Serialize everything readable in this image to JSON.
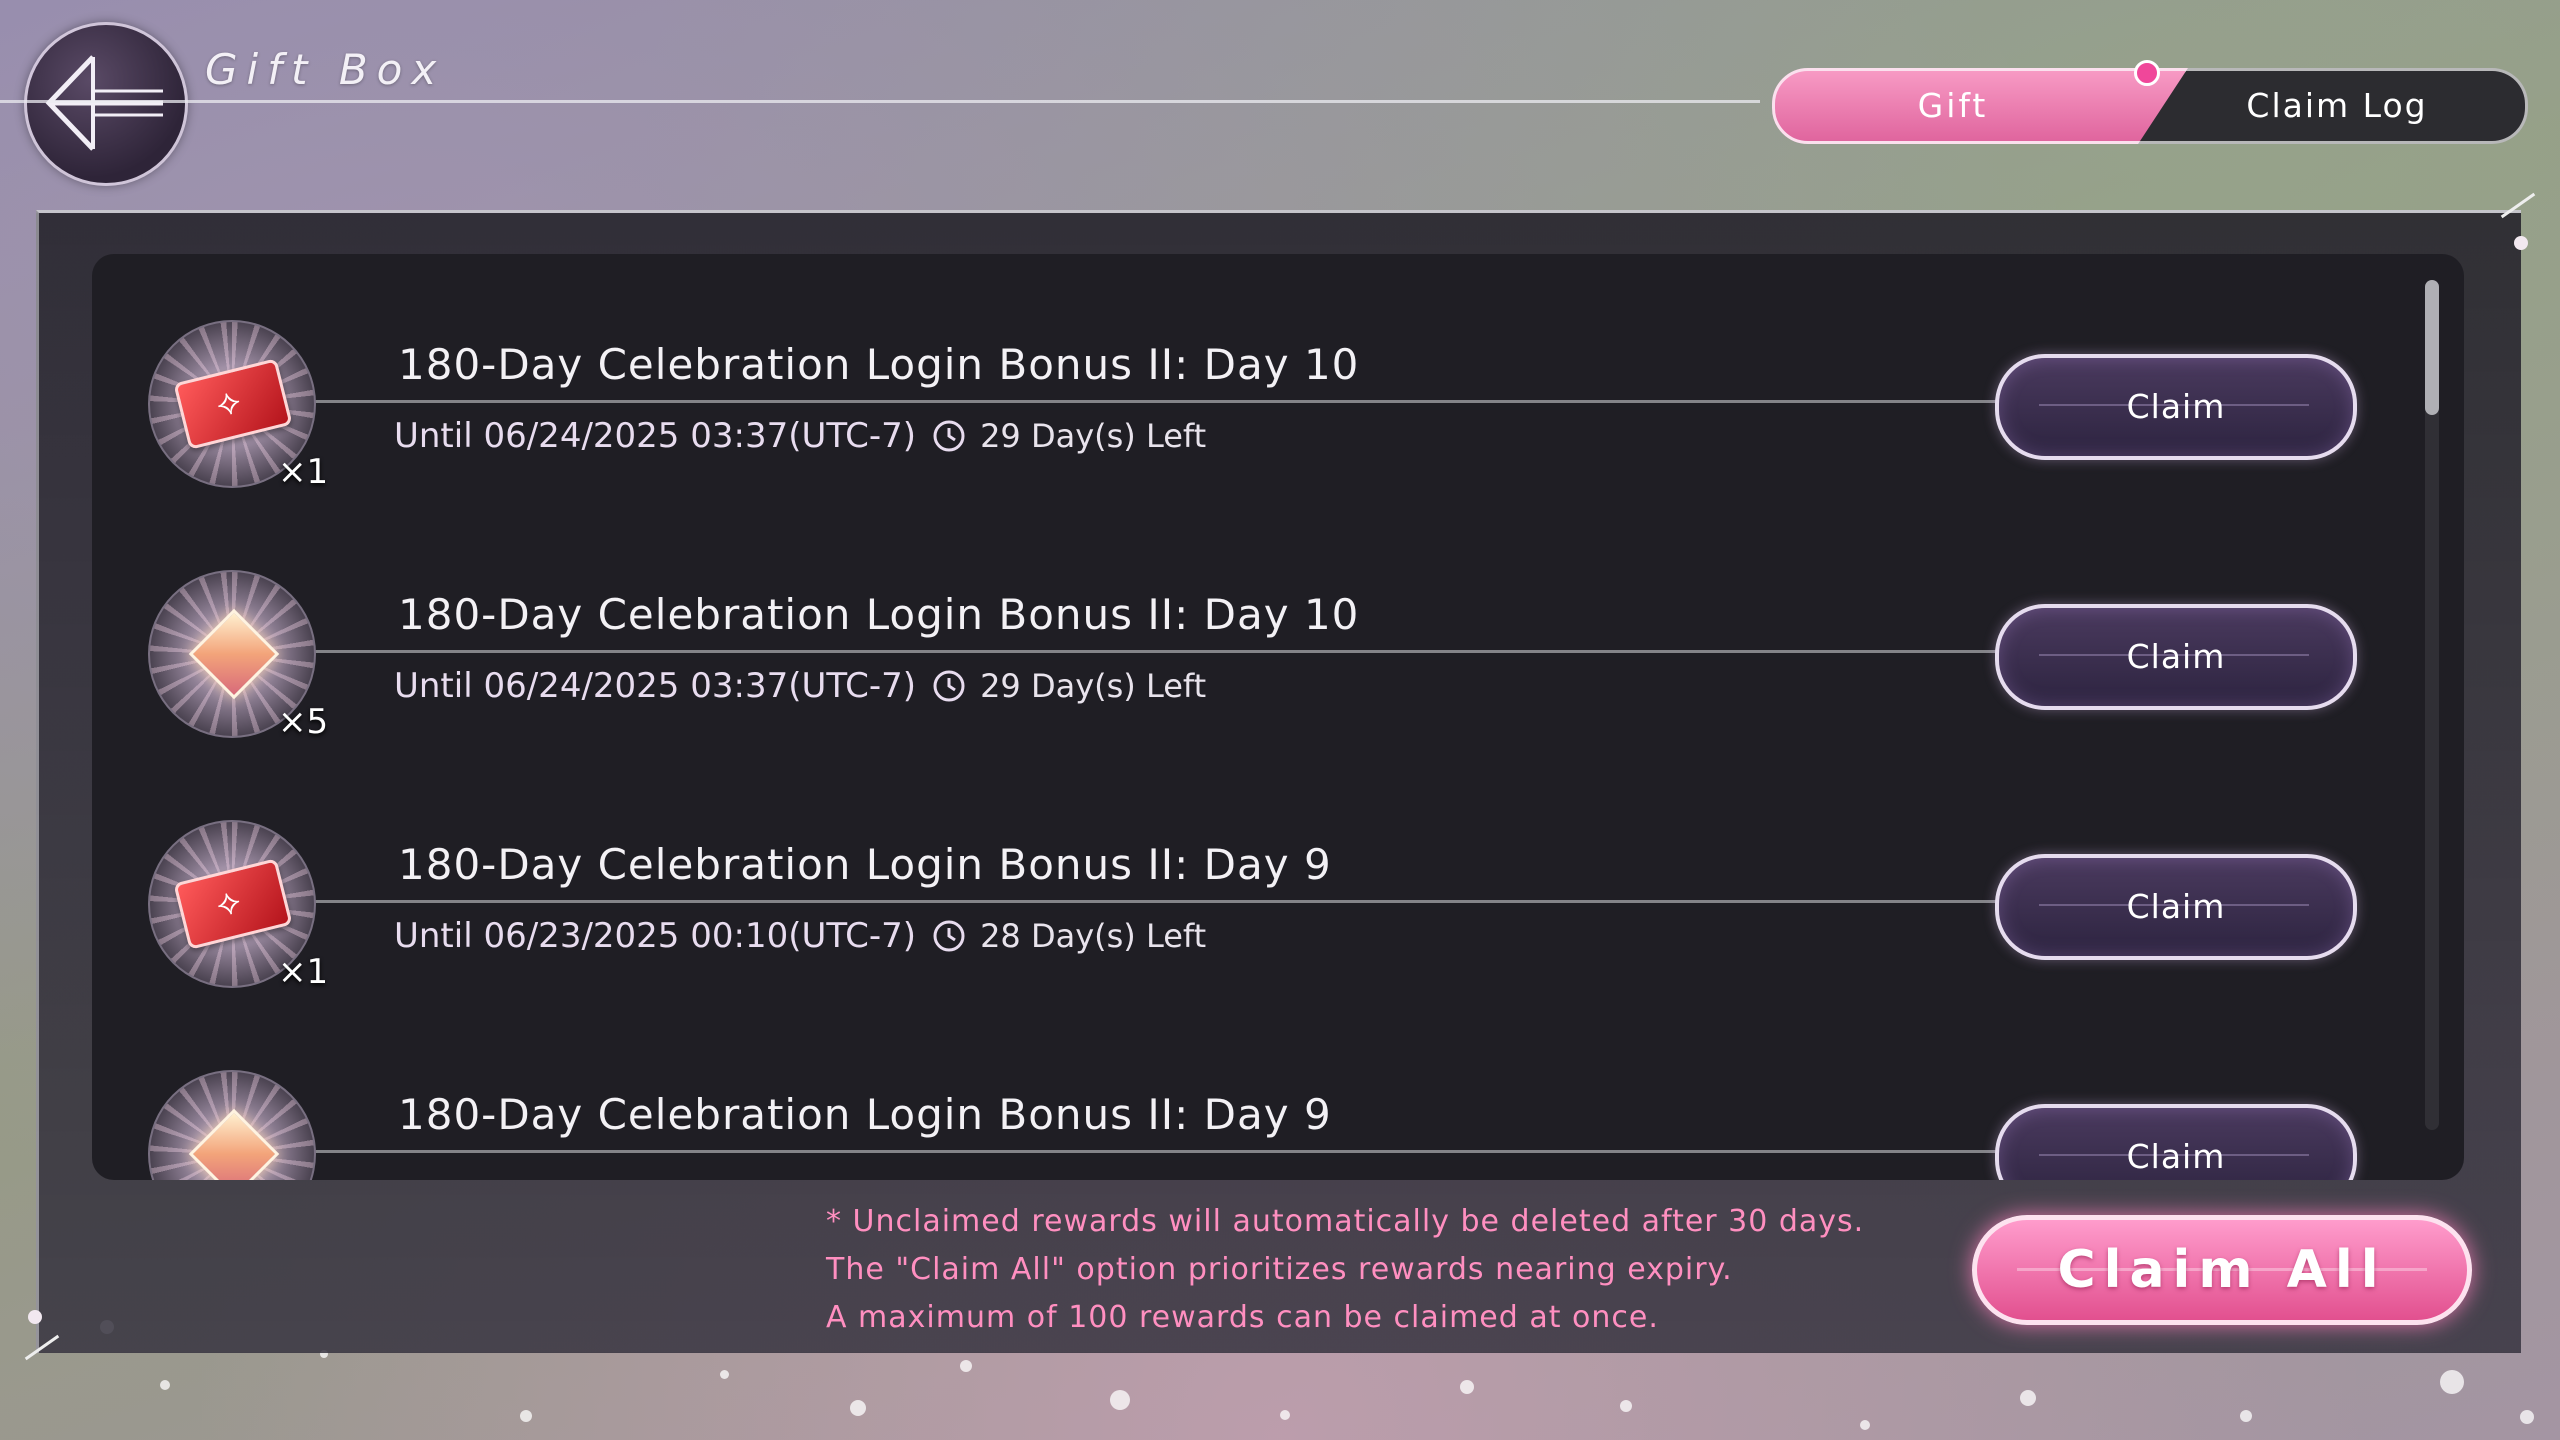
{
  "header": {
    "title": "Gift Box",
    "back_icon": "back-arrow-icon"
  },
  "tabs": [
    {
      "label": "Gift",
      "active": true,
      "has_notification": true
    },
    {
      "label": "Claim Log",
      "active": false
    }
  ],
  "gifts": [
    {
      "title": "180-Day Celebration Login Bonus II: Day 10",
      "item_icon": "red-ticket-icon",
      "quantity": "×1",
      "expiry": "Until 06/24/2025 03:37(UTC-7)",
      "time_left": "29 Day(s) Left",
      "button": "Claim"
    },
    {
      "title": "180-Day Celebration Login Bonus II: Day 10",
      "item_icon": "crystal-gem-icon",
      "quantity": "×5",
      "expiry": "Until 06/24/2025 03:37(UTC-7)",
      "time_left": "29 Day(s) Left",
      "button": "Claim"
    },
    {
      "title": "180-Day Celebration Login Bonus II: Day 9",
      "item_icon": "red-ticket-icon",
      "quantity": "×1",
      "expiry": "Until 06/23/2025 00:10(UTC-7)",
      "time_left": "28 Day(s) Left",
      "button": "Claim"
    },
    {
      "title": "180-Day Celebration Login Bonus II: Day 9",
      "item_icon": "crystal-gem-icon",
      "quantity": "",
      "expiry": "",
      "time_left": "",
      "button": "Claim"
    }
  ],
  "notes": [
    "* Unclaimed rewards will automatically be deleted after 30 days.",
    "The \"Claim All\" option prioritizes rewards nearing expiry.",
    "A maximum of 100 rewards can be claimed at once."
  ],
  "claim_all_label": "Claim All",
  "colors": {
    "accent_pink": "#e2508f",
    "note_pink": "#ff8fc0",
    "panel_dark": "#1f1e24"
  }
}
